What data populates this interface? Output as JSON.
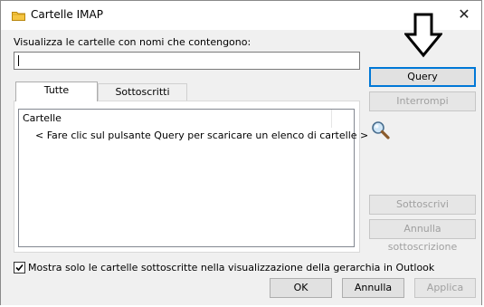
{
  "window": {
    "title": "Cartelle IMAP",
    "close_glyph": "✕"
  },
  "filter": {
    "label": "Visualizza le cartelle con nomi che contengono:",
    "value": ""
  },
  "tabs": [
    {
      "label": "Tutte",
      "active": true
    },
    {
      "label": "Sottoscritti",
      "active": false
    }
  ],
  "list": {
    "column_header": "Cartelle",
    "message": "< Fare clic sul pulsante Query per scaricare un elenco di cartelle >"
  },
  "side_buttons": {
    "query": "Query",
    "stop": "Interrompi",
    "subscribe": "Sottoscrivi",
    "unsubscribe": "Annulla sottoscrizione"
  },
  "option": {
    "label": "Mostra solo le cartelle sottoscritte nella visualizzazione della gerarchia in Outlook",
    "checked": true
  },
  "footer": {
    "ok": "OK",
    "cancel": "Annulla",
    "apply": "Applica"
  },
  "icons": {
    "title": "folder-icon",
    "pointer": "down-arrow-icon",
    "search": "magnifier-icon"
  },
  "colors": {
    "accent": "#0078d7",
    "dialog_bg": "#f0f0f0",
    "disabled_text": "#a0a0a0"
  }
}
